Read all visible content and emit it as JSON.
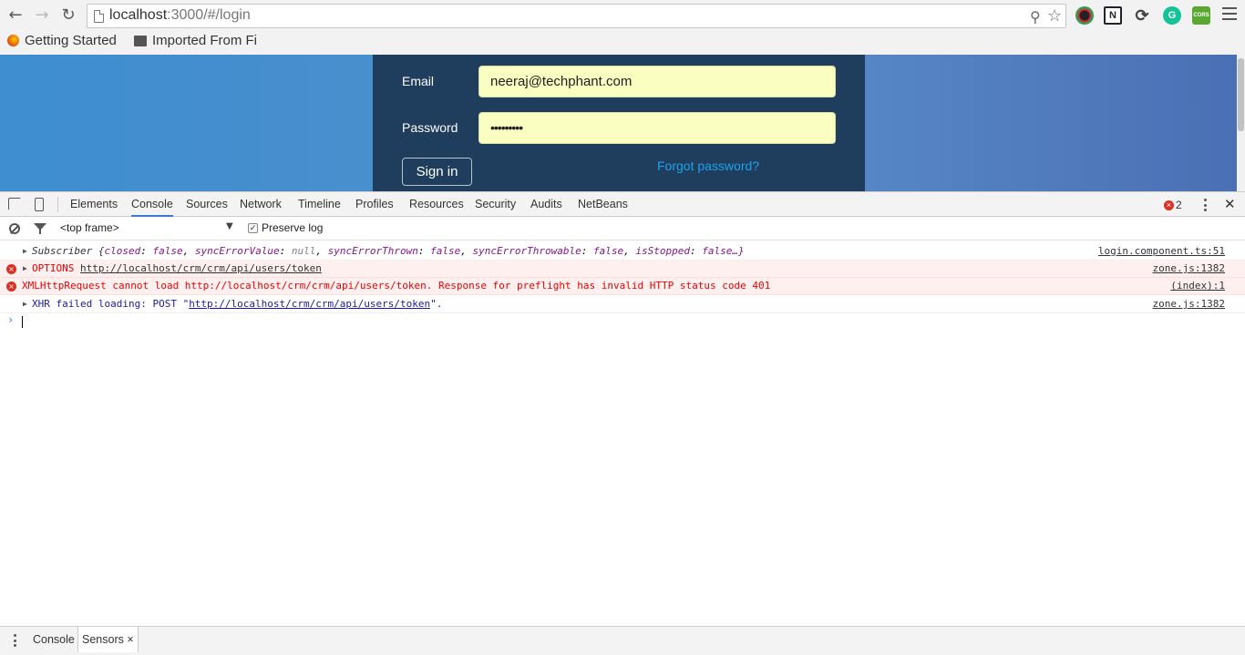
{
  "browser": {
    "url_host": "localhost",
    "url_rest": ":3000/#/login",
    "bookmarks": [
      "Getting Started",
      "Imported From Fi"
    ],
    "extensions": [
      "color-wheel-icon",
      "n-extension-icon",
      "sync-icon",
      "grammarly-icon",
      "cors-icon"
    ],
    "cors_label": "CORS",
    "grammarly_label": "G",
    "n_label": "N"
  },
  "login": {
    "email_label": "Email",
    "email_value": "neeraj@techphant.com",
    "password_label": "Password",
    "password_value": "•••••••••",
    "signin_label": "Sign in",
    "forgot_label": "Forgot password?"
  },
  "devtools": {
    "tabs": [
      "Elements",
      "Console",
      "Sources",
      "Network",
      "Timeline",
      "Profiles",
      "Resources",
      "Security",
      "Audits",
      "NetBeans"
    ],
    "active_tab": "Console",
    "error_count": "2",
    "frame": "<top frame>",
    "preserve_log_label": "Preserve log",
    "messages": {
      "m1_prefix": "Subscriber {",
      "m1_closed_k": "closed",
      "m1_closed_v": "false",
      "m1_sev_k": "syncErrorValue",
      "m1_sev_v": "null",
      "m1_set_k": "syncErrorThrown",
      "m1_set_v": "false",
      "m1_seth_k": "syncErrorThrowable",
      "m1_seth_v": "false",
      "m1_stop_k": "isStopped",
      "m1_stop_v": "false…}",
      "m1_src": "login.component.ts:51",
      "m2_method": "OPTIONS",
      "m2_url": "http://localhost/crm/crm/api/users/token",
      "m2_src": "zone.js:1382",
      "m3_text": "XMLHttpRequest cannot load http://localhost/crm/crm/api/users/token. Response for preflight has invalid HTTP status code 401",
      "m3_src": "(index):1",
      "m4_prefix": "XHR failed loading: POST \"",
      "m4_url": "http://localhost/crm/crm/api/users/token",
      "m4_suffix": "\".",
      "m4_src": "zone.js:1382"
    },
    "prompt_symbol": "›"
  },
  "drawer": {
    "tabs": [
      "Console",
      "Sensors"
    ],
    "active_tab": "Sensors",
    "close_symbol": "×"
  },
  "colors": {
    "accent": "#3879d9",
    "error": "#d93025",
    "link": "#1ca3ec"
  }
}
